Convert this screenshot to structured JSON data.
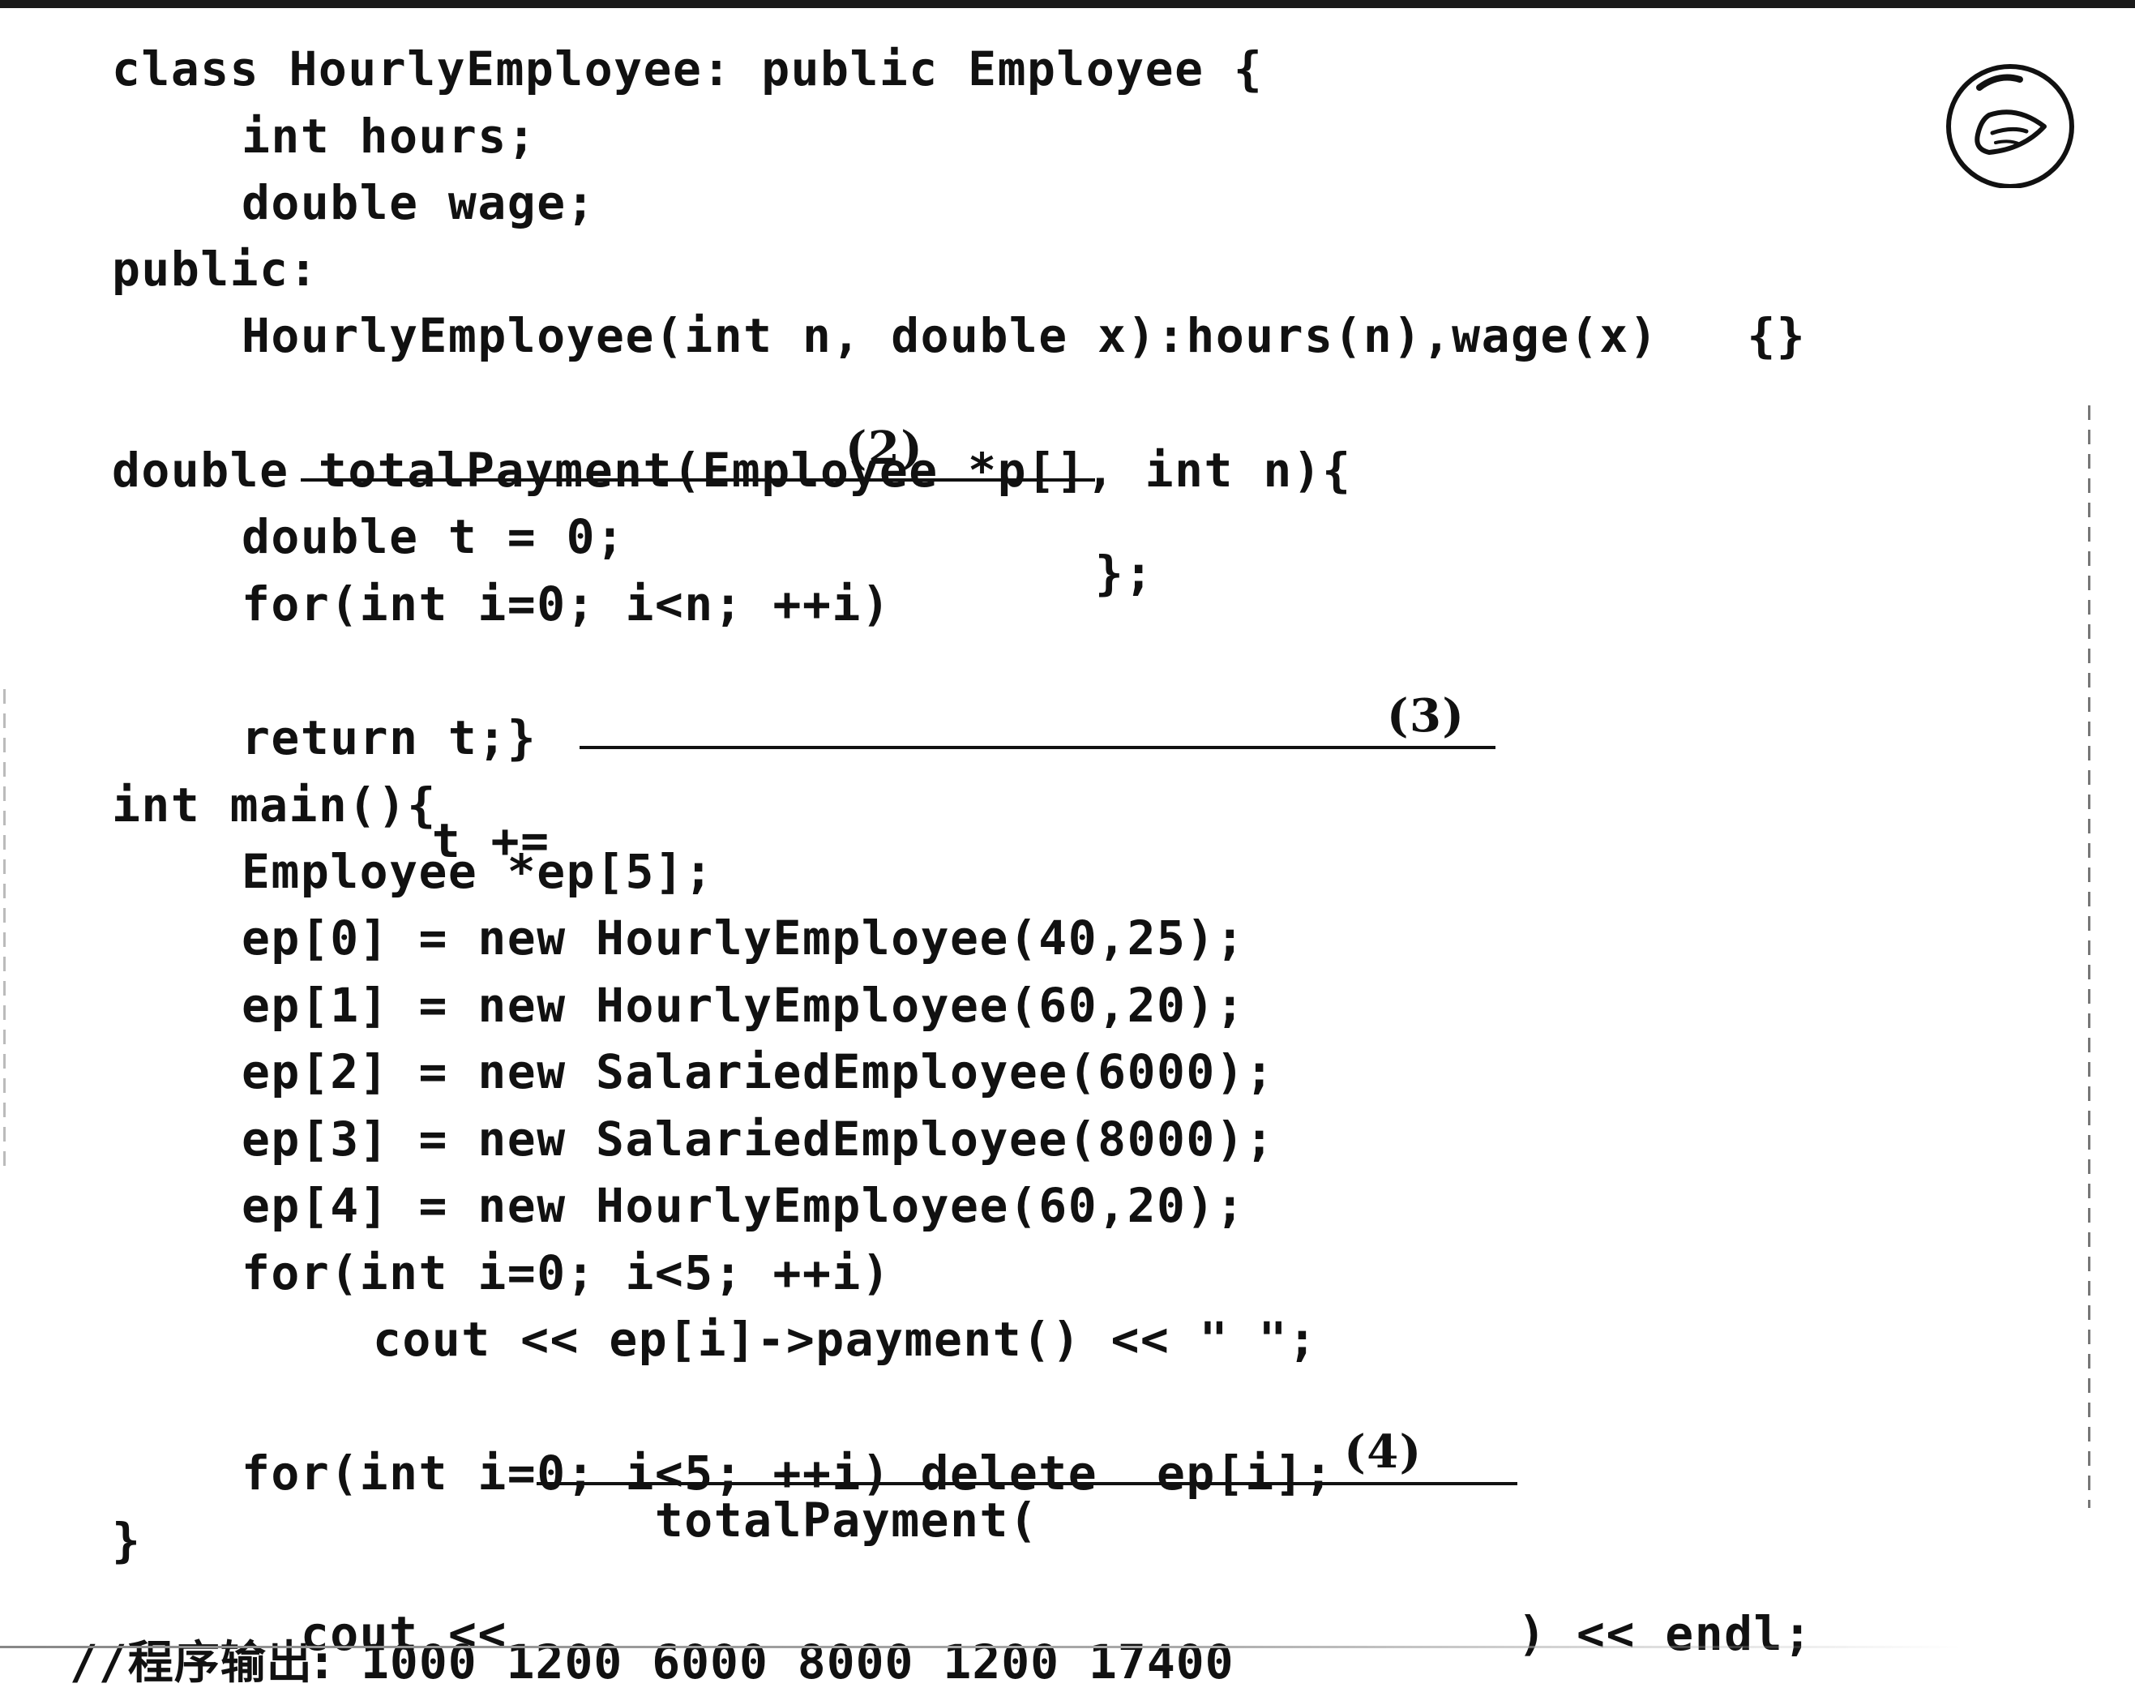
{
  "code": {
    "line_01": "class HourlyEmployee: public Employee {",
    "line_02": "int hours;",
    "line_03": "double wage;",
    "line_04": "public:",
    "line_05": "HourlyEmployee(int n, double x):hours(n),wage(x)   {}",
    "line_06_suffix": "};",
    "line_07": "double totalPayment(Employee *p[], int n){",
    "line_08": "double t = 0;",
    "line_09": "for(int i=0; i<n; ++i)",
    "line_10_prefix": "t += ",
    "line_11": "return t;}",
    "line_12": "int main(){",
    "line_13": "Employee *ep[5];",
    "line_14": "ep[0] = new HourlyEmployee(40,25);",
    "line_15": "ep[1] = new HourlyEmployee(60,20);",
    "line_16": "ep[2] = new SalariedEmployee(6000);",
    "line_17": "ep[3] = new SalariedEmployee(8000);",
    "line_18": "ep[4] = new HourlyEmployee(60,20);",
    "line_19": "for(int i=0; i<5; ++i)",
    "line_20": "cout << ep[i]->payment() << \" \";",
    "line_21_prefix": "cout << ",
    "line_21_call": "totalPayment(",
    "line_21_suffix": ") << endl;",
    "line_22": "for(int i=0; i<5; ++i) delete  ep[i];",
    "line_23": "}"
  },
  "blanks": {
    "blank_2": "(2)",
    "blank_3": "(3)",
    "blank_4": "(4)"
  },
  "output": {
    "prefix": "//",
    "label": "程序输出:",
    "values": "1000 1200 6000 8000 1200 17400"
  },
  "badge_icon": "pointing-hand-icon"
}
